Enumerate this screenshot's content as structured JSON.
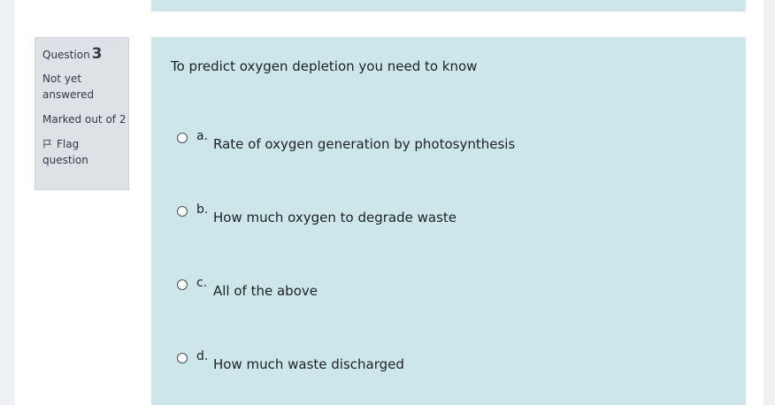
{
  "question_info": {
    "label": "Question",
    "number": "3",
    "state": "Not yet answered",
    "grade": "Marked out of 2",
    "flag_label": "Flag question"
  },
  "question": {
    "text": "To predict oxygen depletion you need to know",
    "options": [
      {
        "letter": "a.",
        "text": "Rate of oxygen generation by photosynthesis"
      },
      {
        "letter": "b.",
        "text": "How much oxygen to degrade waste"
      },
      {
        "letter": "c.",
        "text": "All of the above"
      },
      {
        "letter": "d.",
        "text": "How much waste discharged"
      }
    ]
  },
  "colors": {
    "content_bg": "#cce6ea",
    "info_bg": "#dee2e6"
  },
  "icons": {
    "flag": "flag-icon"
  }
}
